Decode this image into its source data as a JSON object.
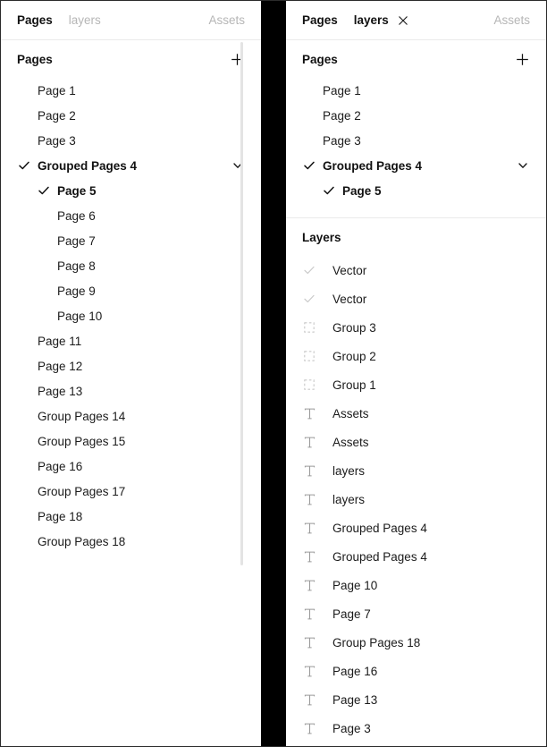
{
  "left_panel": {
    "tabs": [
      {
        "label": "Pages",
        "state": "active",
        "closable": false
      },
      {
        "label": "layers",
        "state": "inactive",
        "closable": false
      }
    ],
    "assets_tab": "Assets",
    "pages_section": {
      "title": "Pages",
      "add_icon": "plus-icon",
      "items": [
        {
          "label": "Page 1",
          "level": 0,
          "checked": false,
          "selected": false,
          "chevron": false
        },
        {
          "label": "Page 2",
          "level": 0,
          "checked": false,
          "selected": false,
          "chevron": false
        },
        {
          "label": "Page 3",
          "level": 0,
          "checked": false,
          "selected": false,
          "chevron": false
        },
        {
          "label": "Grouped Pages 4",
          "level": 0,
          "checked": true,
          "selected": true,
          "chevron": true
        },
        {
          "label": "Page 5",
          "level": 1,
          "checked": true,
          "selected": true,
          "chevron": false
        },
        {
          "label": "Page 6",
          "level": 1,
          "checked": false,
          "selected": false,
          "chevron": false
        },
        {
          "label": "Page 7",
          "level": 1,
          "checked": false,
          "selected": false,
          "chevron": false
        },
        {
          "label": "Page 8",
          "level": 1,
          "checked": false,
          "selected": false,
          "chevron": false
        },
        {
          "label": "Page 9",
          "level": 1,
          "checked": false,
          "selected": false,
          "chevron": false
        },
        {
          "label": "Page 10",
          "level": 1,
          "checked": false,
          "selected": false,
          "chevron": false
        },
        {
          "label": "Page 11",
          "level": 0,
          "checked": false,
          "selected": false,
          "chevron": false
        },
        {
          "label": "Page 12",
          "level": 0,
          "checked": false,
          "selected": false,
          "chevron": false
        },
        {
          "label": "Page 13",
          "level": 0,
          "checked": false,
          "selected": false,
          "chevron": false
        },
        {
          "label": "Group Pages 14",
          "level": 0,
          "checked": false,
          "selected": false,
          "chevron": false
        },
        {
          "label": "Group Pages 15",
          "level": 0,
          "checked": false,
          "selected": false,
          "chevron": false
        },
        {
          "label": "Page 16",
          "level": 0,
          "checked": false,
          "selected": false,
          "chevron": false
        },
        {
          "label": "Group Pages 17",
          "level": 0,
          "checked": false,
          "selected": false,
          "chevron": false
        },
        {
          "label": "Page 18",
          "level": 0,
          "checked": false,
          "selected": false,
          "chevron": false
        },
        {
          "label": "Group Pages 18",
          "level": 0,
          "checked": false,
          "selected": false,
          "chevron": false
        }
      ]
    }
  },
  "right_panel": {
    "tabs": [
      {
        "label": "Pages",
        "state": "active",
        "closable": false
      },
      {
        "label": "layers",
        "state": "active",
        "closable": true,
        "close_icon": "close-icon"
      }
    ],
    "assets_tab": "Assets",
    "pages_section": {
      "title": "Pages",
      "add_icon": "plus-icon",
      "items": [
        {
          "label": "Page 1",
          "level": 0,
          "checked": false,
          "selected": false,
          "chevron": false
        },
        {
          "label": "Page 2",
          "level": 0,
          "checked": false,
          "selected": false,
          "chevron": false
        },
        {
          "label": "Page 3",
          "level": 0,
          "checked": false,
          "selected": false,
          "chevron": false
        },
        {
          "label": "Grouped Pages 4",
          "level": 0,
          "checked": true,
          "selected": true,
          "chevron": true
        },
        {
          "label": "Page 5",
          "level": 1,
          "checked": true,
          "selected": true,
          "chevron": false
        }
      ]
    },
    "layers_section": {
      "title": "Layers",
      "items": [
        {
          "label": "Vector",
          "icon": "vector-check-icon"
        },
        {
          "label": "Vector",
          "icon": "vector-check-icon"
        },
        {
          "label": "Group 3",
          "icon": "group-frame-icon"
        },
        {
          "label": "Group 2",
          "icon": "group-frame-icon"
        },
        {
          "label": "Group 1",
          "icon": "group-frame-icon"
        },
        {
          "label": "Assets",
          "icon": "text-layer-icon"
        },
        {
          "label": "Assets",
          "icon": "text-layer-icon"
        },
        {
          "label": "layers",
          "icon": "text-layer-icon"
        },
        {
          "label": "layers",
          "icon": "text-layer-icon"
        },
        {
          "label": "Grouped Pages 4",
          "icon": "text-layer-icon"
        },
        {
          "label": "Grouped Pages 4",
          "icon": "text-layer-icon"
        },
        {
          "label": "Page 10",
          "icon": "text-layer-icon"
        },
        {
          "label": "Page 7",
          "icon": "text-layer-icon"
        },
        {
          "label": "Group Pages 18",
          "icon": "text-layer-icon"
        },
        {
          "label": "Page 16",
          "icon": "text-layer-icon"
        },
        {
          "label": "Page 13",
          "icon": "text-layer-icon"
        },
        {
          "label": "Page 3",
          "icon": "text-layer-icon"
        }
      ]
    }
  },
  "colors": {
    "text_primary": "#111111",
    "text_muted": "#b6b6b6",
    "icon_muted": "#c9c9c9",
    "icon_text_layer": "#9a9a9a",
    "divider": "#eaeaea",
    "separator_bar": "#000000",
    "scrollbar": "#e4e4e4",
    "background": "#ffffff"
  }
}
